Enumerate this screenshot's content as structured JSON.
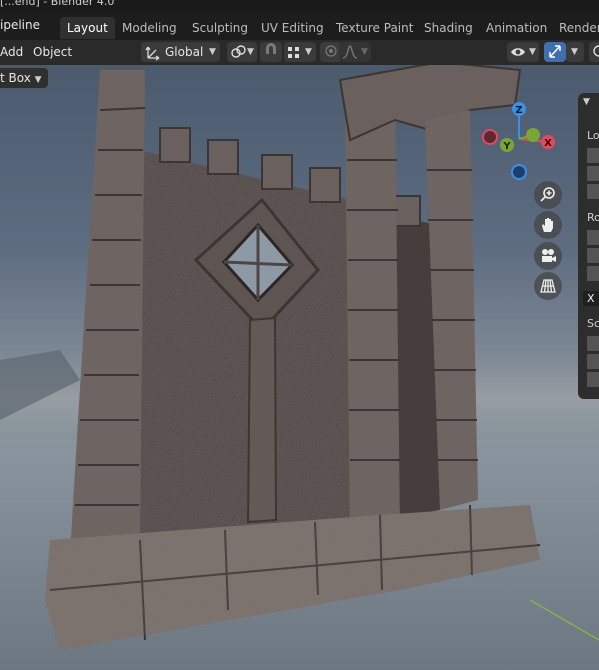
{
  "window": {
    "title": "[...end] - Blender 4.0"
  },
  "app_menu": "ipeline",
  "tabs": [
    {
      "label": "Layout",
      "active": true
    },
    {
      "label": "Modeling",
      "active": false
    },
    {
      "label": "Sculpting",
      "active": false
    },
    {
      "label": "UV Editing",
      "active": false
    },
    {
      "label": "Texture Paint",
      "active": false
    },
    {
      "label": "Shading",
      "active": false
    },
    {
      "label": "Animation",
      "active": false
    },
    {
      "label": "Renderi",
      "active": false
    }
  ],
  "header": {
    "add_label": "Add",
    "object_label": "Object",
    "transform_orientation": "Global"
  },
  "viewport": {
    "select_mode": "t Box"
  },
  "gizmo": {
    "x": "X",
    "y": "Y",
    "z": "Z"
  },
  "sidebar": {
    "section_location": "Lo",
    "section_rotation": "Ro",
    "rotation_mode": "X",
    "section_scale": "Sc"
  },
  "colors": {
    "axis_x": "#e44a5c",
    "axis_y": "#7aa636",
    "axis_z": "#3c8fe8",
    "active_blue": "#3f6fae"
  },
  "icons": [
    "transform-orientation-icon",
    "snap-icon",
    "proportional-icon",
    "visibility-icon",
    "gizmo-toggle-icon",
    "zoom-icon",
    "hand-icon",
    "camera-icon",
    "grid-icon"
  ]
}
